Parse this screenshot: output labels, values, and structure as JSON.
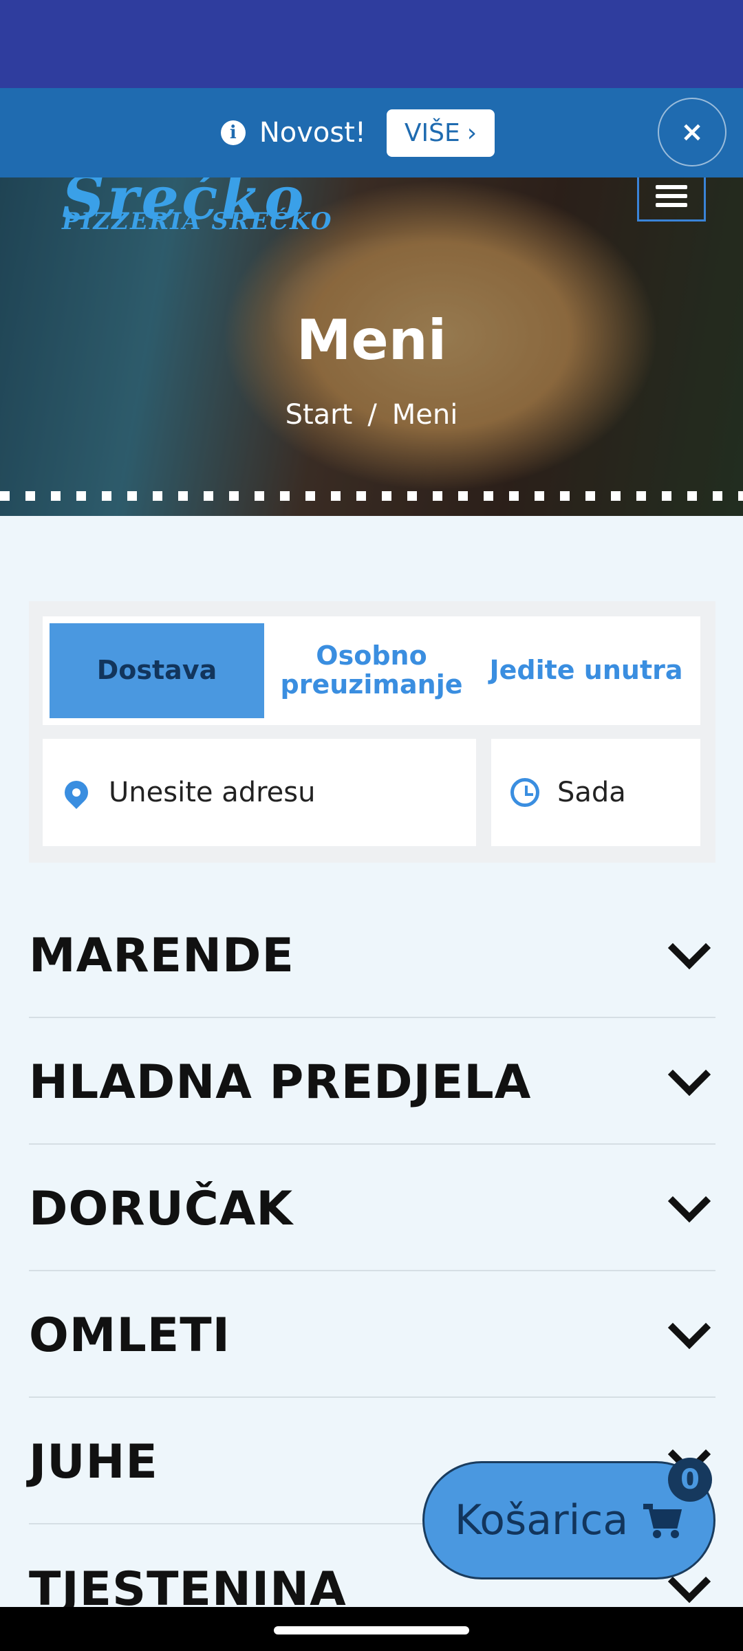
{
  "notice": {
    "info_icon": "info-circle-icon",
    "text": "Novost!",
    "more_label": "VIŠE",
    "more_icon": "chevron-right-icon",
    "close_icon": "close-icon",
    "close_glyph": "×"
  },
  "header": {
    "logo_main": "Srećko",
    "logo_sub": "PIZZERIA SREĆKO",
    "menu_icon": "hamburger-menu-icon"
  },
  "hero": {
    "title": "Meni",
    "breadcrumb": [
      "Start",
      "/",
      "Meni"
    ]
  },
  "order": {
    "tabs": [
      {
        "label": "Dostava",
        "active": true
      },
      {
        "label": "Osobno preuzimanje",
        "active": false
      },
      {
        "label": "Jedite unutra",
        "active": false
      }
    ],
    "address_placeholder": "Unesite adresu",
    "address_icon": "location-pin-icon",
    "time_value": "Sada",
    "time_icon": "clock-icon"
  },
  "categories": [
    {
      "name": "MARENDE"
    },
    {
      "name": "HLADNA PREDJELA"
    },
    {
      "name": "DORUČAK"
    },
    {
      "name": "OMLETI"
    },
    {
      "name": "JUHE"
    },
    {
      "name": "TJESTENINA"
    }
  ],
  "cart": {
    "label": "Košarica",
    "count": "0",
    "icon": "shopping-cart-icon"
  },
  "colors": {
    "status_bar": "#2f3d9e",
    "notice_bar": "#1f6bb0",
    "accent": "#4a98e0",
    "accent_text": "#3a8ee0"
  }
}
